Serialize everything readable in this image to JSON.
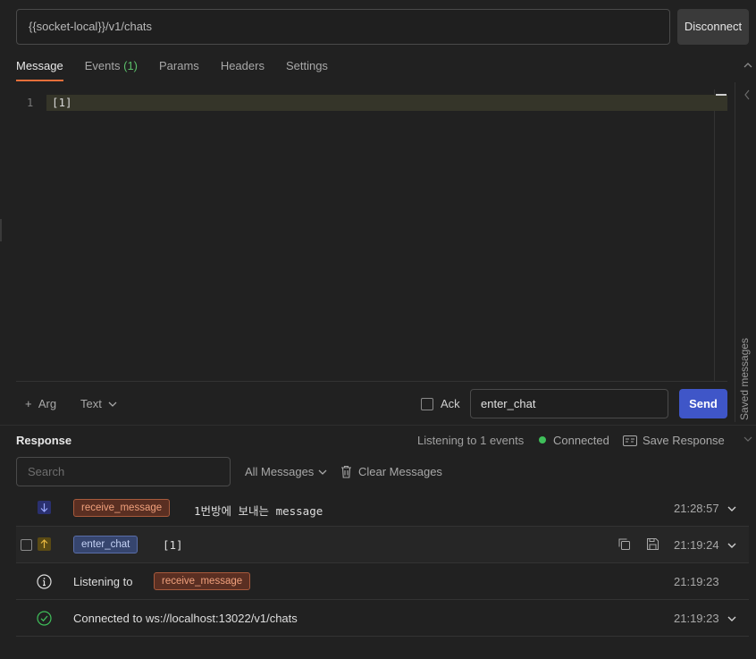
{
  "url_bar": {
    "value": "{{socket-local}}/v1/chats",
    "disconnect_label": "Disconnect"
  },
  "tabs": [
    {
      "label": "Message"
    },
    {
      "label": "Events",
      "count": "(1)"
    },
    {
      "label": "Params"
    },
    {
      "label": "Headers"
    },
    {
      "label": "Settings"
    }
  ],
  "editor": {
    "line_number": "1",
    "code": "[1]"
  },
  "side_panel": {
    "label": "Saved messages"
  },
  "footer": {
    "arg_label": "Arg",
    "format_label": "Text",
    "ack_label": "Ack",
    "event_name": "enter_chat",
    "send_label": "Send"
  },
  "response": {
    "title": "Response",
    "listening": "Listening to 1 events",
    "status": "Connected",
    "save_label": "Save Response",
    "search_placeholder": "Search",
    "filter_label": "All Messages",
    "clear_label": "Clear Messages",
    "rows": [
      {
        "event": "receive_message",
        "message": "1번방에 보내는 message",
        "time": "21:28:57"
      },
      {
        "event": "enter_chat",
        "message": "[1]",
        "time": "21:19:24"
      },
      {
        "prefix": "Listening to",
        "event": "receive_message",
        "time": "21:19:23"
      },
      {
        "message": "Connected to ws://localhost:13022/v1/chats",
        "time": "21:19:23"
      }
    ]
  },
  "colors": {
    "accent": "#e56f3a",
    "send": "#3f56c8",
    "connected": "#3fbf5a"
  }
}
